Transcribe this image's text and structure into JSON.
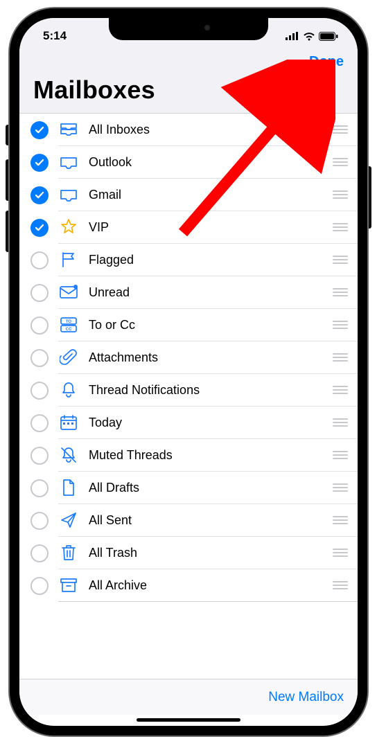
{
  "status": {
    "time": "5:14"
  },
  "nav": {
    "done": "Done"
  },
  "title": "Mailboxes",
  "toolbar": {
    "new_mailbox": "New Mailbox"
  },
  "items": [
    {
      "id": "all-inboxes",
      "label": "All Inboxes",
      "checked": true,
      "icon": "inbox-stack"
    },
    {
      "id": "outlook",
      "label": "Outlook",
      "checked": true,
      "icon": "inbox"
    },
    {
      "id": "gmail",
      "label": "Gmail",
      "checked": true,
      "icon": "inbox"
    },
    {
      "id": "vip",
      "label": "VIP",
      "checked": true,
      "icon": "star"
    },
    {
      "id": "flagged",
      "label": "Flagged",
      "checked": false,
      "icon": "flag"
    },
    {
      "id": "unread",
      "label": "Unread",
      "checked": false,
      "icon": "envelope-dot"
    },
    {
      "id": "to-cc",
      "label": "To or Cc",
      "checked": false,
      "icon": "to-cc"
    },
    {
      "id": "attachments",
      "label": "Attachments",
      "checked": false,
      "icon": "paperclip"
    },
    {
      "id": "thread-notifications",
      "label": "Thread Notifications",
      "checked": false,
      "icon": "bell"
    },
    {
      "id": "today",
      "label": "Today",
      "checked": false,
      "icon": "calendar"
    },
    {
      "id": "muted",
      "label": "Muted Threads",
      "checked": false,
      "icon": "bell-slash"
    },
    {
      "id": "drafts",
      "label": "All Drafts",
      "checked": false,
      "icon": "doc"
    },
    {
      "id": "sent",
      "label": "All Sent",
      "checked": false,
      "icon": "paperplane"
    },
    {
      "id": "trash",
      "label": "All Trash",
      "checked": false,
      "icon": "trash"
    },
    {
      "id": "archive",
      "label": "All Archive",
      "checked": false,
      "icon": "archive"
    }
  ]
}
